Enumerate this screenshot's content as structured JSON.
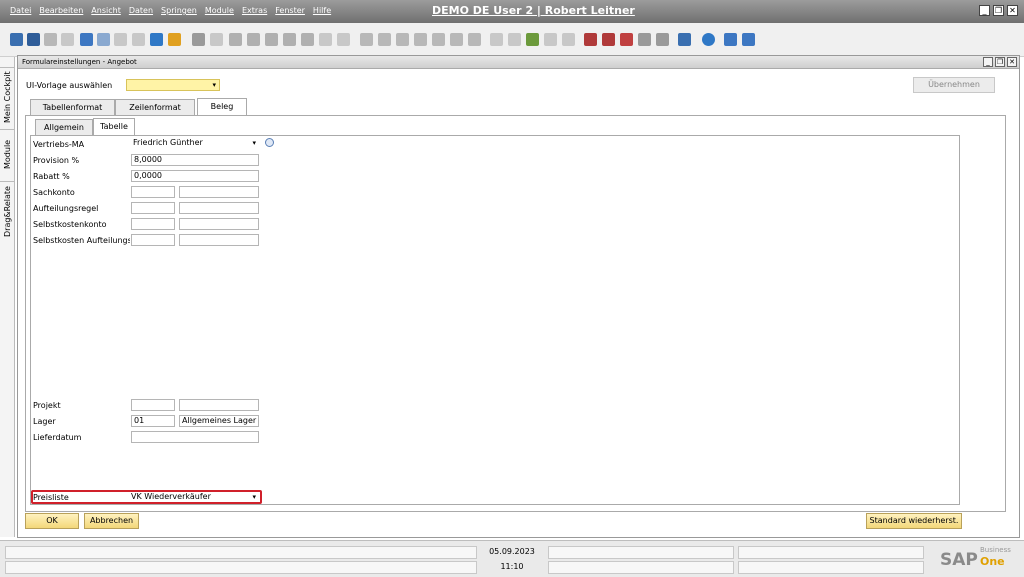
{
  "app": {
    "title": "DEMO DE User 2 | Robert Leitner"
  },
  "menu": [
    "Datei",
    "Bearbeiten",
    "Ansicht",
    "Daten",
    "Springen",
    "Module",
    "Extras",
    "Fenster",
    "Hilfe"
  ],
  "sidebar_tabs": [
    "Mein Cockpit",
    "Module",
    "Drag&Relate"
  ],
  "form": {
    "title": "Formulareinstellungen - Angebot",
    "ui_template_label": "UI-Vorlage auswählen",
    "ui_template_value": "",
    "apply_button": "Übernehmen",
    "main_tabs": [
      "Tabellenformat",
      "Zeilenformat",
      "Beleg"
    ],
    "sub_tabs": [
      "Allgemein",
      "Tabelle"
    ],
    "fields": {
      "vertriebs_label": "Vertriebs-MA",
      "vertriebs_value": "Friedrich Günther",
      "provision_label": "Provision %",
      "provision_value": "8,0000",
      "rabatt_label": "Rabatt %",
      "rabatt_value": "0,0000",
      "sachkonto_label": "Sachkonto",
      "aufteilungsregel_label": "Aufteilungsregel",
      "selbstkostenkonto_label": "Selbstkostenkonto",
      "selbstkosten_aufteilung_label": "Selbstkosten Aufteilungsre",
      "projekt_label": "Projekt",
      "lager_label": "Lager",
      "lager_code": "01",
      "lager_name": "Allgemeines Lager",
      "lieferdatum_label": "Lieferdatum",
      "preisliste_label": "Preisliste",
      "preisliste_value": "VK Wiederverkäufer"
    },
    "ok_button": "OK",
    "cancel_button": "Abbrechen",
    "restore_button": "Standard wiederherst."
  },
  "status": {
    "date": "05.09.2023",
    "time": "11:10",
    "logo_sap": "SAP",
    "logo_business": "Business",
    "logo_one": "One"
  }
}
